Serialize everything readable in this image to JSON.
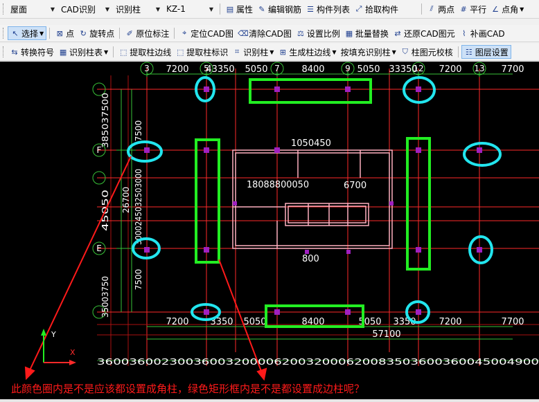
{
  "toolbar1": {
    "floor": "屋面",
    "cad_mode": "CAD识别",
    "identify": "识别柱",
    "component": "KZ-1",
    "attr_btn": "属性",
    "edit_rebar_btn": "编辑钢筋",
    "component_list_btn": "构件列表",
    "pick_component_btn": "拾取构件",
    "two_point_btn": "两点",
    "parallel_btn": "平行",
    "point_angle_btn": "点角"
  },
  "toolbar2": {
    "select_btn": "选择",
    "point_btn": "点",
    "rotate_point_btn": "旋转点",
    "original_mark_btn": "原位标注",
    "locate_cad_btn": "定位CAD图",
    "clear_cad_btn": "清除CAD图",
    "set_scale_btn": "设置比例",
    "batch_replace_btn": "批量替换",
    "restore_cad_btn": "还原CAD图元",
    "add_cad_btn": "补画CAD"
  },
  "toolbar3": {
    "convert_symbol_btn": "转换符号",
    "identify_column_table_btn": "识别柱表",
    "extract_column_edge_btn": "提取柱边线",
    "extract_column_label_btn": "提取柱标识",
    "identify_column_btn": "识别柱",
    "generate_column_edge_btn": "生成柱边线",
    "fill_identify_btn": "按填充识别柱",
    "column_check_btn": "柱图元校核",
    "layer_settings_btn": "图层设置"
  },
  "drawing": {
    "axis_top": [
      "3",
      "5",
      "7",
      "9",
      "12",
      "13"
    ],
    "axis_left": [
      "F",
      "E"
    ],
    "dims_top": [
      "7200",
      "43350",
      "5050",
      "8400",
      "5050",
      "33350",
      "7200",
      "7700"
    ],
    "dims_bottom": [
      "7200",
      "3350",
      "5050",
      "8400",
      "5050",
      "3350",
      "7200",
      "7700"
    ],
    "total_bottom": "57100",
    "left_dims_vertical": [
      "7500",
      "26700",
      "7500"
    ],
    "left_dense_labels": [
      "385037500",
      "3000245032503000",
      "45050",
      "35003750"
    ],
    "bottom_dense_labels": "3600360023003600320000620032000620083503600360045004900",
    "center_labels": [
      "1050450",
      "18088800050",
      "6700",
      "800"
    ],
    "question": "此颜色圈内是不是应该都设置成角柱，绿色矩形框内是不是都设置成边柱呢？",
    "ucs_y": "Y",
    "ucs_x": "X"
  },
  "colors": {
    "cyan_mark": "#22e5ee",
    "green_mark": "#22ee22",
    "annotation_red": "#ff1a1a",
    "axis_line": "#ff2a2a",
    "wall_outline": "#ffb0c0",
    "column_point": "#a020c0"
  }
}
